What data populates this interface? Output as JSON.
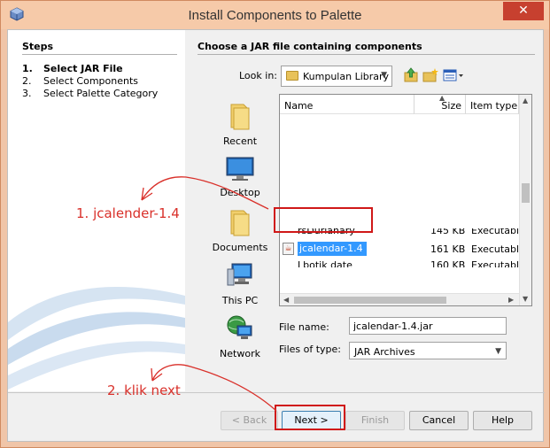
{
  "window": {
    "title": "Install Components to Palette",
    "close_glyph": "✕"
  },
  "steps": {
    "title": "Steps",
    "items": [
      {
        "num": "1.",
        "label": "Select JAR File"
      },
      {
        "num": "2.",
        "label": "Select Components"
      },
      {
        "num": "3.",
        "label": "Select Palette Category"
      }
    ]
  },
  "main": {
    "title": "Choose a JAR file containing components",
    "look_in_label": "Look in:",
    "look_in_value": "Kumpulan Library",
    "places": [
      "Recent",
      "Desktop",
      "Documents",
      "This PC",
      "Network"
    ],
    "columns": [
      "Name",
      "Size",
      "Item type"
    ],
    "files": [
      {
        "name": "rsDurianary",
        "size": "145 KB",
        "type": "Executable"
      },
      {
        "name": "jcalendar-1.4",
        "size": "161 KB",
        "type": "Executable"
      },
      {
        "name": "Lbotik date",
        "size": "160 KB",
        "type": "Executable"
      }
    ],
    "file_name_label": "File name:",
    "file_name_value": "jcalendar-1.4.jar",
    "files_of_type_label": "Files of type:",
    "files_of_type_value": "JAR Archives"
  },
  "buttons": {
    "back": "< Back",
    "next": "Next >",
    "finish": "Finish",
    "cancel": "Cancel",
    "help": "Help"
  },
  "annotations": {
    "step1": "1. jcalender-1.4",
    "step2": "2. klik next",
    "color": "#d9302a"
  }
}
